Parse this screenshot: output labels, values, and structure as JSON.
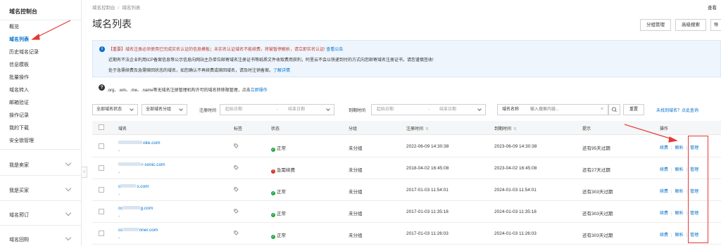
{
  "sidebar": {
    "title": "域名控制台",
    "items": [
      {
        "label": "概览"
      },
      {
        "label": "域名列表",
        "active": true
      },
      {
        "label": "历史域名记录"
      },
      {
        "label": "信息模板"
      },
      {
        "label": "批量操作"
      },
      {
        "label": "域名转入"
      },
      {
        "label": "邮箱验证"
      },
      {
        "label": "操作记录"
      },
      {
        "label": "我的下载"
      },
      {
        "label": "安全锁管理"
      }
    ],
    "groups": [
      {
        "label": "我是卖家"
      },
      {
        "label": "我是买家"
      },
      {
        "label": "域名预订"
      },
      {
        "label": "域名回购"
      }
    ],
    "collapse_glyph": "‹"
  },
  "breadcrumb": [
    "域名控制台",
    "域名列表"
  ],
  "top_right_text": "查看",
  "page_title": "域名列表",
  "header_buttons": [
    {
      "label": "分组管理"
    },
    {
      "label": "高级搜索"
    },
    {
      "label": "导"
    }
  ],
  "notice": {
    "icon": "i",
    "line1": "【重要】域名注册必须使用已完成实名认证的信息模板；未实名认证域名不能续费，将被暂停解析，请立即实名认证!",
    "line1_link": "查看公告",
    "line2": "近期有不法企业利用ICP备案信息等公示信息向网站主办单位邮寄域名注册证书等纸质文件收取费用获利，阿里云不会以快递到付的方式向您邮寄域名注册证书，请您谨慎签收!",
    "line3": "处于急需续费及急需赎回状态的域名，如您确认不再续费或赎回域名，请及时注销备案。",
    "line3_link": "了解详情"
  },
  "tip": {
    "icon": "?",
    "text": ".org、.win、.me、.name等无域名注册管理机构许可的域名转移限管理，点击",
    "link": "立即操作"
  },
  "filters": {
    "status_select": "全部域名状态",
    "group_select": "全部域名分组",
    "reg_time_label": "注册时间",
    "expire_time_label": "到期时间",
    "start_placeholder": "起始日期",
    "end_placeholder": "结束日期",
    "to_sep": "-",
    "search_label": "域名名称",
    "search_placeholder": "输入搜索内容...",
    "clear_glyph": "×",
    "reset_button": "重置",
    "not_found_link": "未找到域名？点此查询"
  },
  "table": {
    "columns": {
      "name": "域名",
      "tag": "标签",
      "status": "状态",
      "group": "分组",
      "reg_time": "注册时间",
      "expire_time": "到期时间",
      "hint": "提示",
      "ops": "操作"
    },
    "sort_glyph": "⇅",
    "rows": [
      {
        "domain_suffix": "oke.com",
        "sub": "-",
        "status": "正常",
        "status_type": "ok",
        "group": "未分组",
        "reg": "2022-06-09 14:30:38",
        "exp": "2023-06-09 14:30:38",
        "hint": "还有95天过期"
      },
      {
        "domain_suffix": "r-sonic.com",
        "sub": "-",
        "status": "急需续费",
        "status_type": "bad",
        "group": "未分组",
        "reg": "2018-04-02 16:45:08",
        "exp": "2023-04-02 16:45:08",
        "hint": "还有27天过期"
      },
      {
        "domain_suffix": "s.com",
        "domain_prefix": "c",
        "sub": "-",
        "status": "正常",
        "status_type": "ok",
        "group": "未分组",
        "reg": "2017-01-03 11:54:01",
        "exp": "2024-01-03 11:54:01",
        "hint": "还有303天过期"
      },
      {
        "domain_suffix": "g.com",
        "domain_prefix": "cc",
        "sub": "-",
        "status": "正常",
        "status_type": "ok",
        "group": "未分组",
        "reg": "2017-01-03 11:35:18",
        "exp": "2024-01-03 11:35:18",
        "hint": "还有303天过期"
      },
      {
        "domain_suffix": "nner.com",
        "domain_prefix": "cc",
        "sub": "-",
        "status": "正常",
        "status_type": "ok",
        "group": "未分组",
        "reg": "2017-01-03 11:26:03",
        "exp": "2024-01-03 11:26:03",
        "hint": "还有303天过期"
      }
    ],
    "actions": {
      "renew": "续费",
      "resolve": "解析",
      "manage": "管理"
    }
  },
  "colors": {
    "accent": "#0070cc",
    "annotation": "#e53935",
    "ok": "#22a640",
    "bad": "#d93026"
  }
}
